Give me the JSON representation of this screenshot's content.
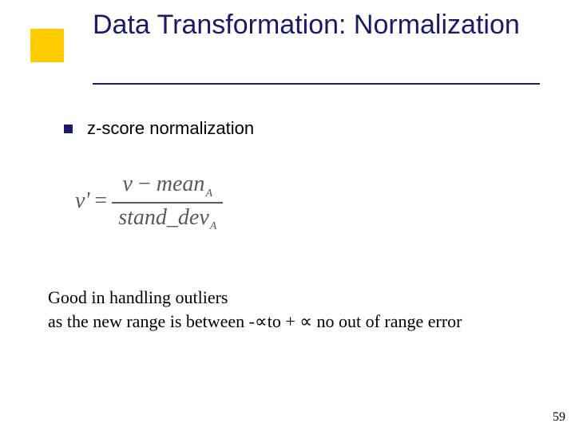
{
  "title": "Data Transformation: Normalization",
  "bullet": {
    "text": "z-score normalization"
  },
  "formula": {
    "lhs": "v'",
    "num_left": "v",
    "num_minus": "−",
    "num_right": "mean",
    "num_sub": "A",
    "den_left": "stand",
    "den_underscore": "_",
    "den_right": "dev",
    "den_sub": "A"
  },
  "body": "Good in handling outliers\nas the new range is between -∝to + ∝ no out of range error",
  "page_number": "59"
}
